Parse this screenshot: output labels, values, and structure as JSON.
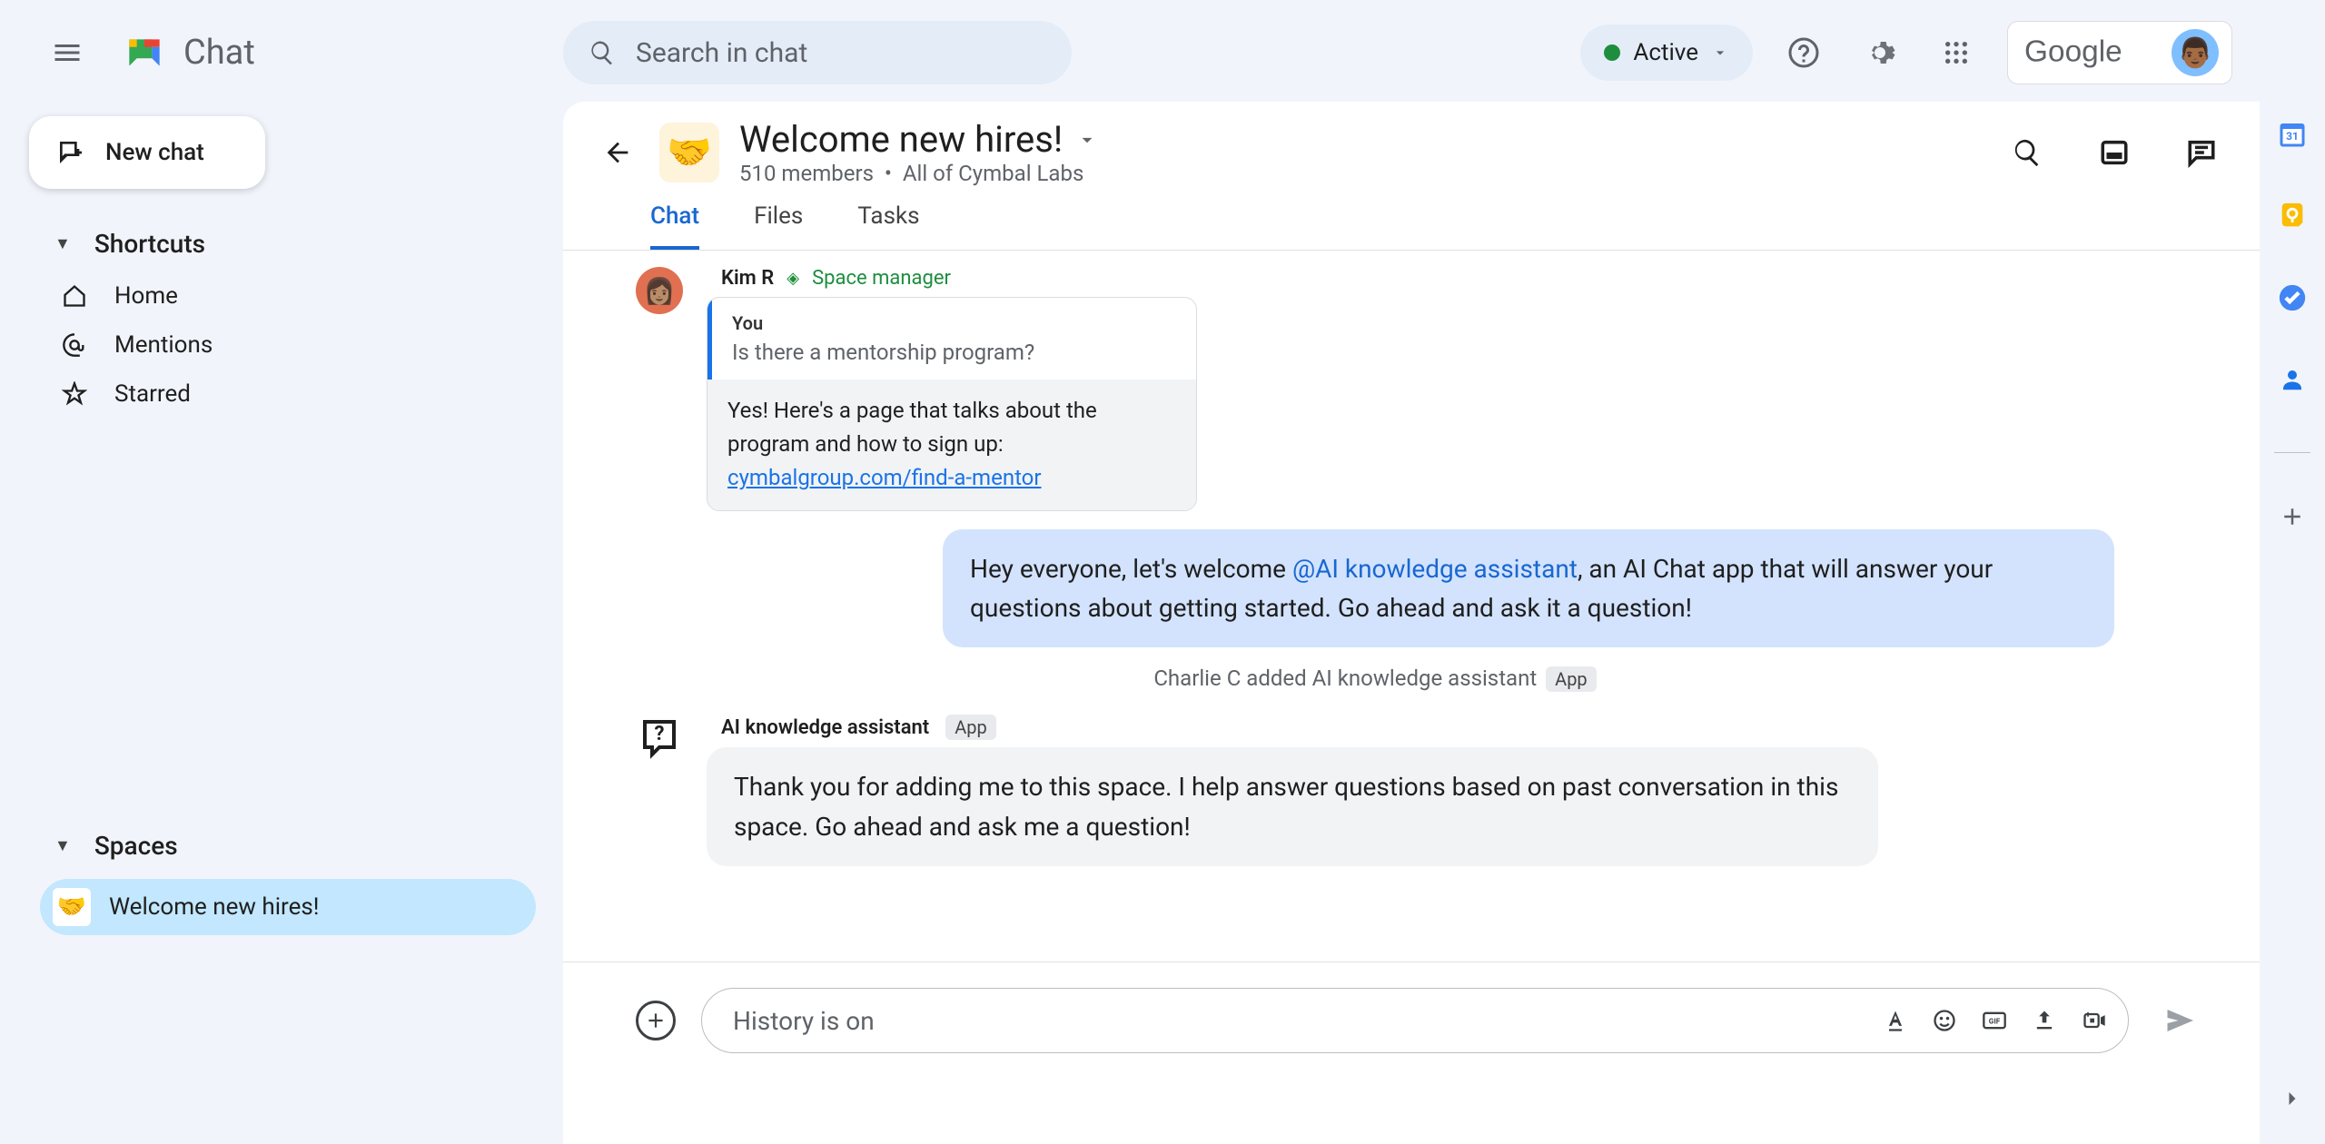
{
  "app": {
    "name": "Chat",
    "google_logo_text": "Google"
  },
  "search": {
    "placeholder": "Search in chat"
  },
  "status": {
    "label": "Active"
  },
  "new_chat": {
    "label": "New chat"
  },
  "sidebar": {
    "shortcuts_label": "Shortcuts",
    "shortcuts": [
      {
        "label": "Home"
      },
      {
        "label": "Mentions"
      },
      {
        "label": "Starred"
      }
    ],
    "spaces_label": "Spaces",
    "spaces": [
      {
        "label": "Welcome new hires!",
        "emoji": "🤝"
      }
    ]
  },
  "space": {
    "title": "Welcome new hires!",
    "members": "510 members",
    "scope": "All of Cymbal Labs",
    "emoji": "🤝"
  },
  "tabs": [
    {
      "label": "Chat"
    },
    {
      "label": "Files"
    },
    {
      "label": "Tasks"
    }
  ],
  "messages": {
    "kim": {
      "name": "Kim R",
      "role": "Space manager",
      "quoted_sender": "You",
      "quoted_text": "Is there a mentorship program?",
      "reply_text": "Yes! Here's a page that talks about the program and how to sign up: ",
      "reply_link": "cymbalgroup.com/find-a-mentor"
    },
    "own": {
      "pre": "Hey everyone, let's welcome ",
      "mention": "@AI knowledge assistant",
      "post": ", an AI Chat app that will answer your questions about getting started.  Go ahead and ask it a question!"
    },
    "system": {
      "text": "Charlie C added AI knowledge assistant",
      "badge": "App"
    },
    "bot": {
      "name": "AI knowledge assistant",
      "badge": "App",
      "text": "Thank you for adding me to this space. I help answer questions based on past conversation in this space. Go ahead and ask me a question!"
    }
  },
  "composer": {
    "placeholder": "History is on"
  }
}
